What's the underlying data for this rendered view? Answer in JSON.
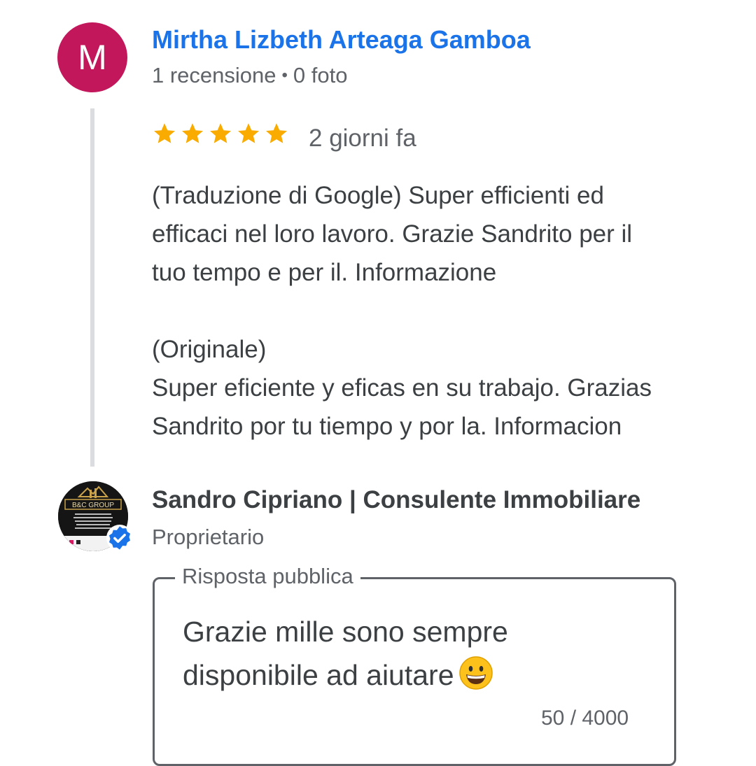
{
  "reviewer": {
    "initial": "M",
    "avatar_color": "#c2185b",
    "name": "Mirtha Lizbeth Arteaga Gamboa",
    "reviews_count": "1 recensione",
    "separator": "•",
    "photos_count": "0 foto"
  },
  "review": {
    "rating": 5,
    "star_color": "#f9ab00",
    "time": "2 giorni fa",
    "translated_text": "(Traduzione di Google) Super efficienti ed\nefficaci nel loro lavoro. Grazie Sandrito per il\ntuo tempo e per il. Informazione",
    "original_label": "(Originale)",
    "original_text": "Super eficiente y eficas en su trabajo. Grazias\nSandrito por tu tiempo y por la. Informacion"
  },
  "owner": {
    "logo_text": "B&C GROUP",
    "name": "Sandro Cipriano | Consulente Immobiliare",
    "role": "Proprietario",
    "verified_color": "#1a73e8"
  },
  "reply": {
    "legend": "Risposta pubblica",
    "text": "Grazie mille sono sempre\ndisponibile ad aiutare",
    "emoji": "grinning-face",
    "char_count": "50 / 4000"
  }
}
